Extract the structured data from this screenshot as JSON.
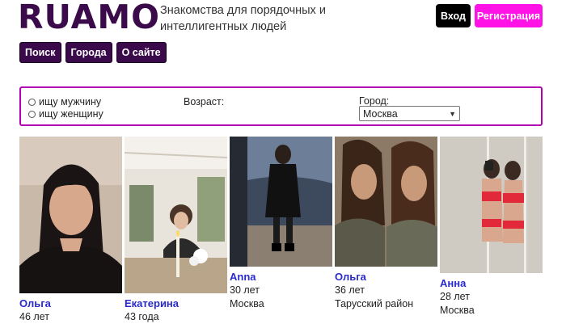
{
  "header": {
    "logo": "RUAMO",
    "tagline": "Знакомства для порядочных и интеллигентных людей",
    "login_label": "Вход",
    "register_label": "Регистрация"
  },
  "nav": [
    "Поиск",
    "Города",
    "О сайте"
  ],
  "filter": {
    "seek_male": "ищу мужчину",
    "seek_female": "ищу женщину",
    "age_label": "Возраст:",
    "city_label": "Город:",
    "city_value": "Москва"
  },
  "profiles": [
    {
      "name": "Ольга",
      "age": "46 лет",
      "location": ""
    },
    {
      "name": "Екатерина",
      "age": "43 года",
      "location": ""
    },
    {
      "name": "Anna",
      "age": "30 лет",
      "location": "Москва"
    },
    {
      "name": "Ольга",
      "age": "36 лет",
      "location": "Тарусский район"
    },
    {
      "name": "Анна",
      "age": "28 лет",
      "location": "Москва"
    }
  ],
  "colors": {
    "brand": "#3a0a4a",
    "register": "#ff12e6",
    "filter_border": "#b300b3",
    "name_link": "#2a2acc"
  }
}
